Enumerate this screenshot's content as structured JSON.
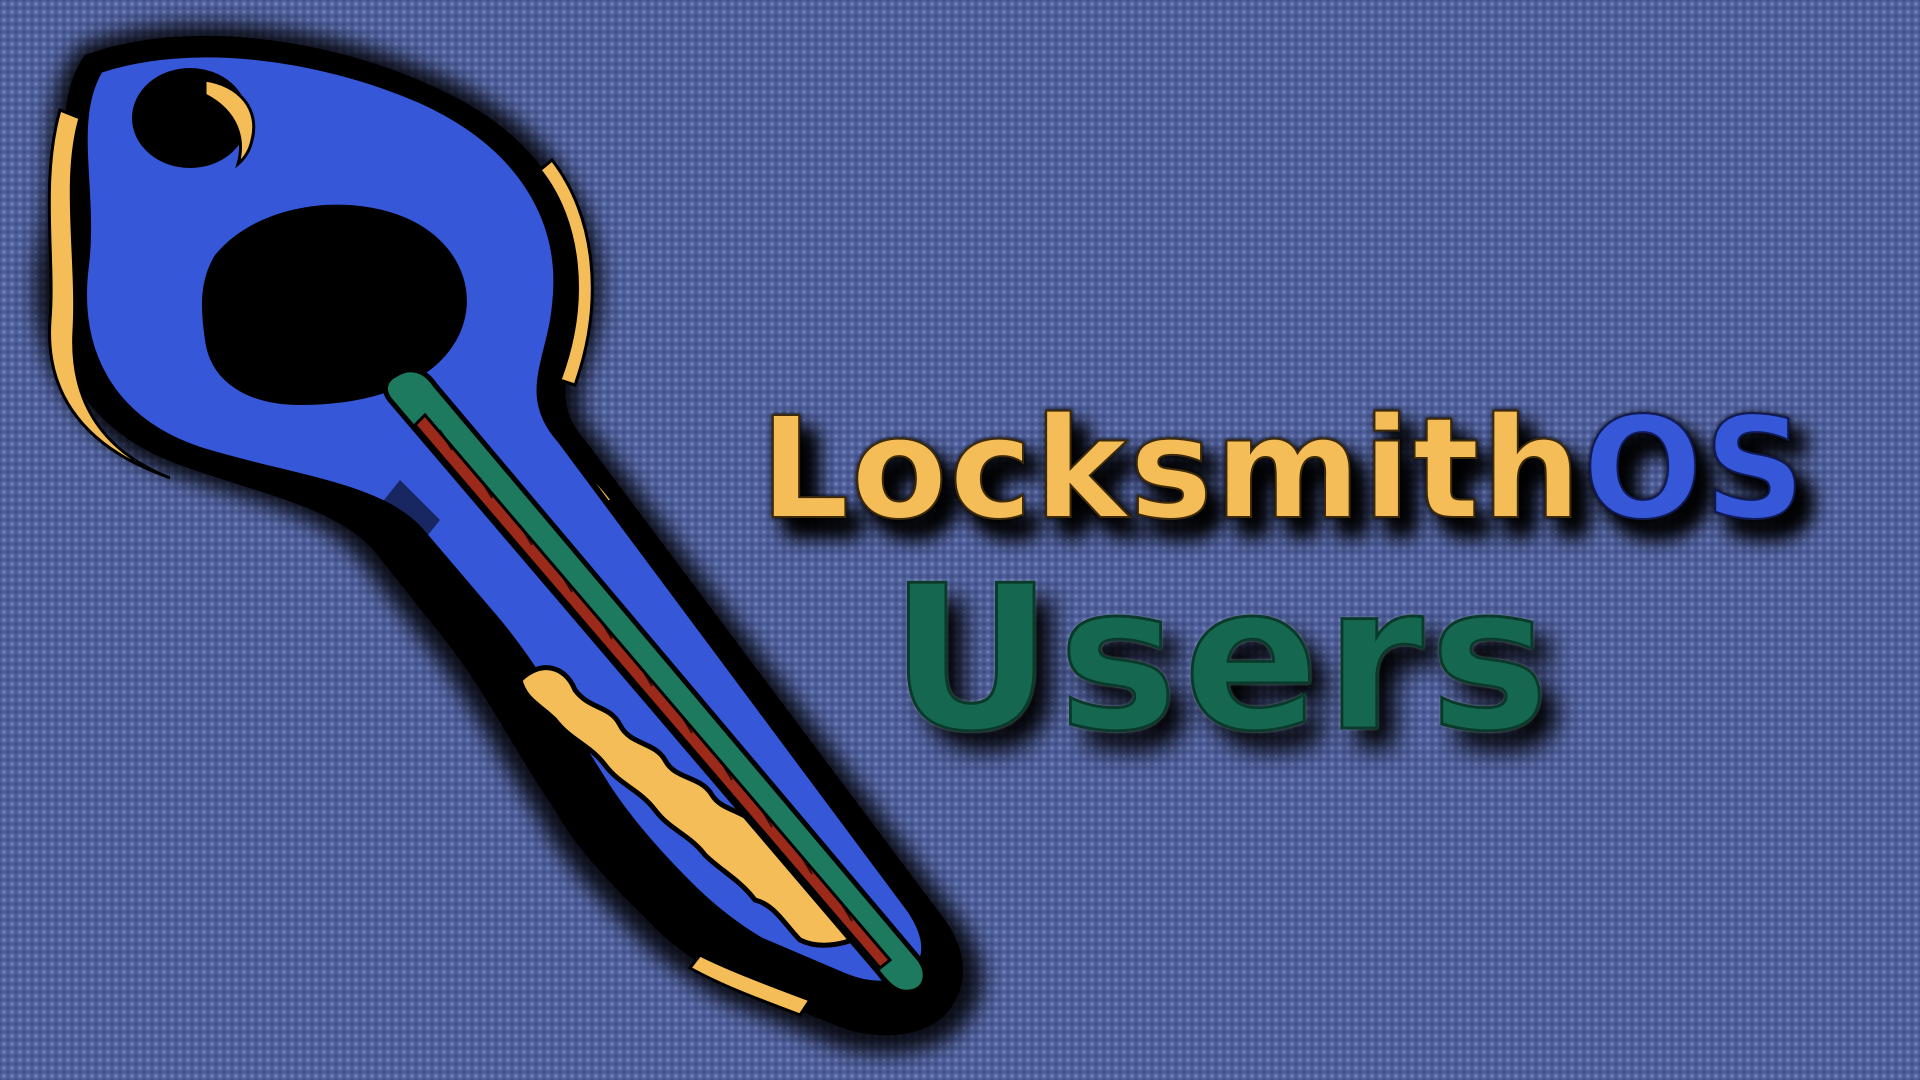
{
  "wallpaper": {
    "background_color": "#4f5f9a",
    "logo": {
      "icon": "key-icon",
      "colors": {
        "key_body": "#3557d8",
        "highlight": "#f4bd58",
        "groove_outer": "#1d7a5f",
        "groove_inner": "#9b2a1a",
        "outline": "#000000"
      }
    },
    "title": {
      "part_a": "Locksmith",
      "part_b": "OS",
      "part_a_color": "#f4bd58",
      "part_b_color": "#3557d8"
    },
    "subtitle": {
      "text": "Users",
      "color": "#15684f"
    }
  }
}
